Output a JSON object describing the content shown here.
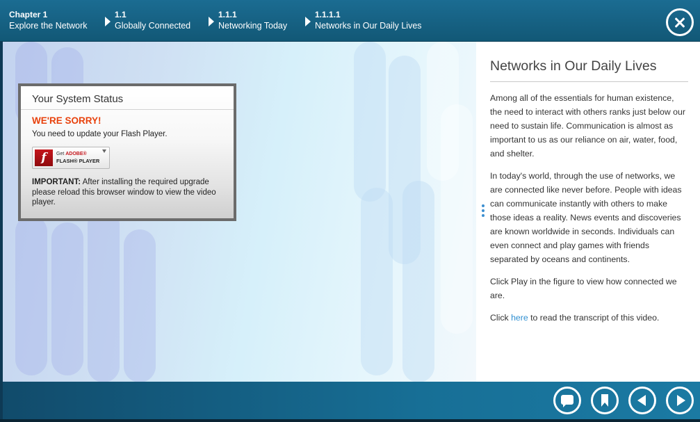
{
  "breadcrumbs": [
    {
      "number": "Chapter 1",
      "label": "Explore the Network"
    },
    {
      "number": "1.1",
      "label": "Globally Connected"
    },
    {
      "number": "1.1.1",
      "label": "Networking Today"
    },
    {
      "number": "1.1.1.1",
      "label": "Networks in Our Daily Lives"
    }
  ],
  "icons": {
    "close": "close-icon",
    "comment": "speech-bubble-icon",
    "bookmark": "bookmark-icon",
    "previous": "previous-arrow-icon",
    "next": "next-arrow-icon",
    "flash": "flash-player-icon"
  },
  "flash_notice": {
    "title": "Your System Status",
    "heading": "WE'RE SORRY!",
    "message": "You need to update your Flash Player.",
    "button": {
      "get_prefix": "Get",
      "brand": "ADOBE®",
      "product": "FLASH® PLAYER",
      "logo_letter": "f"
    },
    "important_label": "IMPORTANT:",
    "important_text": "After installing the required upgrade please reload this browser window to view the video player."
  },
  "article": {
    "title": "Networks in Our Daily Lives",
    "paragraphs": [
      "Among all of the essentials for human existence, the need to interact with others ranks just below our need to sustain life. Communication is almost as important to us as our reliance on air, water, food, and shelter.",
      "In today's world, through the use of networks, we are connected like never before. People with ideas can communicate instantly with others to make those ideas a reality. News events and discoveries are known worldwide in seconds. Individuals can even connect and play games with friends separated by oceans and continents.",
      "Click Play in the figure to view how connected we are."
    ],
    "transcript": {
      "prefix": "Click ",
      "link": "here",
      "suffix": " to read the transcript of this video."
    }
  },
  "colors": {
    "header": "#1b6c92",
    "footer": "#176f96",
    "sorry": "#e8410c",
    "link": "#2f8fd1"
  }
}
